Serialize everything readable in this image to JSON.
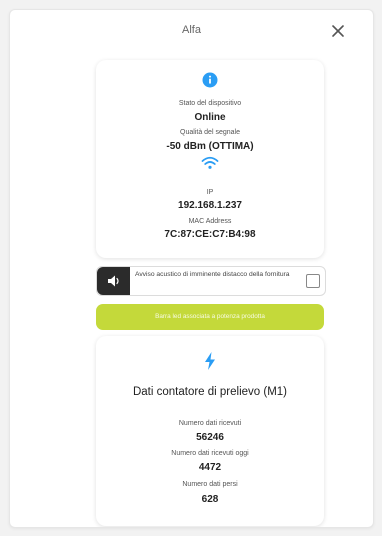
{
  "header": {
    "title": "Alfa",
    "close_icon": "close-icon"
  },
  "device": {
    "info_icon": "info-icon",
    "status_label": "Stato del dispositivo",
    "status_value": "Online",
    "signal_label": "Qualità del segnale",
    "signal_value": "-50 dBm (OTTIMA)",
    "wifi_icon": "wifi-icon",
    "ip_label": "IP",
    "ip_value": "192.168.1.237",
    "mac_label": "MAC Address",
    "mac_value": "7C:87:CE:C7:B4:98"
  },
  "alarm": {
    "icon": "speaker-icon",
    "text": "Avviso acustico di imminente distacco della fornitura",
    "checked": false
  },
  "power_bar": {
    "label": "Barra led associata a potenza prodotta"
  },
  "meter": {
    "bolt_icon": "lightning-bolt-icon",
    "title": "Dati contatore di prelievo (M1)",
    "received_label": "Numero dati ricevuti",
    "received_value": "56246",
    "received_today_label": "Numero dati ricevuti oggi",
    "received_today_value": "4472",
    "lost_label": "Numero dati persi",
    "lost_value": "628"
  },
  "colors": {
    "accent_blue": "#2a9df4",
    "green_bar": "#c4d93a",
    "speaker_bg": "#2b2b2b"
  }
}
